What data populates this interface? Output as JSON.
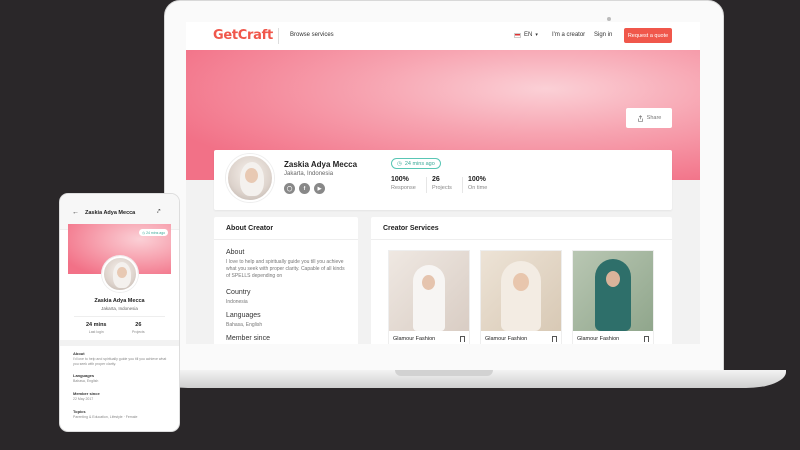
{
  "desktop": {
    "nav": {
      "brand": "GetCraft",
      "browse": "Browse services",
      "lang": "EN",
      "creator": "I'm a creator",
      "signin": "Sign in",
      "quote": "Request a quote"
    },
    "share": "Share",
    "profile": {
      "name": "Zaskia Adya Mecca",
      "location": "Jakarta, Indonesia",
      "last_seen": "24 mins ago",
      "stats": [
        {
          "value": "100%",
          "label": "Response"
        },
        {
          "value": "26",
          "label": "Projects"
        },
        {
          "value": "100%",
          "label": "On time"
        }
      ],
      "socials": [
        "instagram-icon",
        "facebook-icon",
        "youtube-icon"
      ]
    },
    "about": {
      "title": "About Creator",
      "about_h": "About",
      "about_t": "I love to help and spiritually guide you till you achieve what you seek with proper clarity. Capable of all kinds of SPELLS depending on",
      "country_h": "Country",
      "country_t": "Indonesia",
      "languages_h": "Languages",
      "languages_t": "Bahasa, English",
      "member_h": "Member since"
    },
    "services": {
      "title": "Creator Services",
      "items": [
        "Glamour Fashion",
        "Glamour Fashion",
        "Glamour Fashion"
      ]
    }
  },
  "mobile": {
    "title": "Zaskia Adya Mecca",
    "badge": "24 mins ago",
    "name": "Zaskia Adya Mecca",
    "location": "Jakarta, Indonesia",
    "stats": [
      {
        "value": "24 mins",
        "label": "Last login"
      },
      {
        "value": "26",
        "label": "Projects"
      }
    ],
    "about_h": "About",
    "about_t": "I'd love to help and spiritually guide you till you achieve what you seek with proper clarity.",
    "languages_h": "Languages",
    "languages_t": "Bahasa, English",
    "member_h": "Member since",
    "member_t": "22 May 2017",
    "topics_h": "Topics",
    "topics_t": "Parenting & Education, Lifestyle · Female"
  },
  "colors": {
    "brand": "#f0574b",
    "accent_teal": "#59c6b5",
    "banner_pink": "#f27187"
  }
}
